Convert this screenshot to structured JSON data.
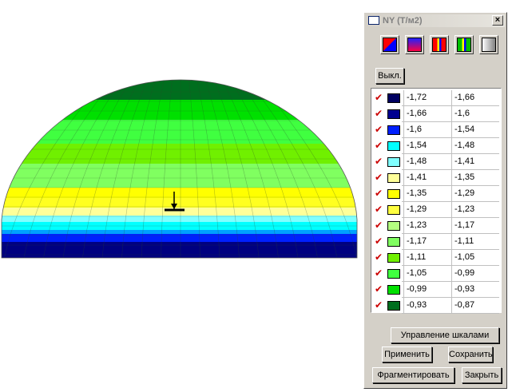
{
  "window": {
    "title": "NY (T/м2)",
    "close_glyph": "×"
  },
  "scheme_buttons": [
    {
      "name": "scheme-red-blue-diagonal",
      "colors": [
        "#ff0000",
        "#0000ff"
      ]
    },
    {
      "name": "scheme-blue-red-gradient",
      "colors": [
        "#2020ff",
        "#ff0040"
      ]
    },
    {
      "name": "scheme-red-yellow-blue",
      "colors": [
        "#ff0000",
        "#ffff00",
        "#0000ff"
      ]
    },
    {
      "name": "scheme-green-yellow-blue",
      "colors": [
        "#00c000",
        "#ffff00",
        "#0000ff"
      ]
    },
    {
      "name": "scheme-grayscale",
      "colors": [
        "#ffffff",
        "#808080"
      ]
    }
  ],
  "off_button_label": "Выкл.",
  "legend": [
    {
      "from": "-1,72",
      "to": "-1,66",
      "color": "#000060",
      "checked": true
    },
    {
      "from": "-1,66",
      "to": "-1,6",
      "color": "#000090",
      "checked": true
    },
    {
      "from": "-1,6",
      "to": "-1,54",
      "color": "#0020ff",
      "checked": true
    },
    {
      "from": "-1,54",
      "to": "-1,48",
      "color": "#00ffff",
      "checked": true
    },
    {
      "from": "-1,48",
      "to": "-1,41",
      "color": "#80ffff",
      "checked": true
    },
    {
      "from": "-1,41",
      "to": "-1,35",
      "color": "#ffff99",
      "checked": true
    },
    {
      "from": "-1,35",
      "to": "-1,29",
      "color": "#ffff00",
      "checked": true
    },
    {
      "from": "-1,29",
      "to": "-1,23",
      "color": "#ffff40",
      "checked": true
    },
    {
      "from": "-1,23",
      "to": "-1,17",
      "color": "#b4ff80",
      "checked": true
    },
    {
      "from": "-1,17",
      "to": "-1,11",
      "color": "#80ff60",
      "checked": true
    },
    {
      "from": "-1,11",
      "to": "-1,05",
      "color": "#70f000",
      "checked": true
    },
    {
      "from": "-1,05",
      "to": "-0,99",
      "color": "#40ff40",
      "checked": true
    },
    {
      "from": "-0,99",
      "to": "-0,93",
      "color": "#00e000",
      "checked": true
    },
    {
      "from": "-0,93",
      "to": "-0,87",
      "color": "#006e1e",
      "checked": true
    }
  ],
  "check_glyph": "✔",
  "buttons": {
    "scale_control": "Управление шкалами",
    "apply": "Применить",
    "save": "Сохранить",
    "fragment": "Фрагментировать",
    "close": "Закрыть"
  }
}
